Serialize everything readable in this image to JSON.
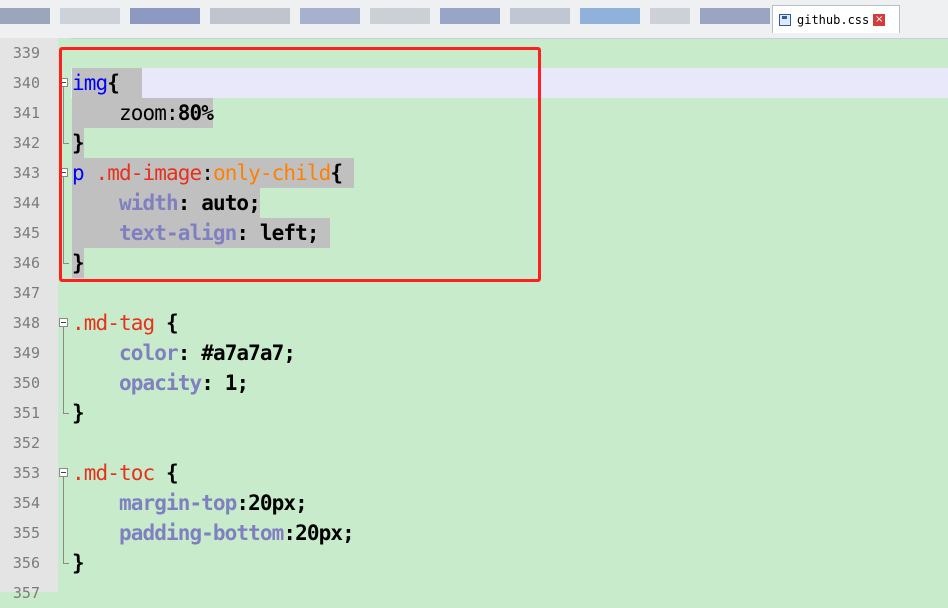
{
  "tabbar": {
    "active_tab": {
      "label": "github.css",
      "icon": "save-icon",
      "close_icon": "close-icon"
    },
    "blurred_tab_colors": [
      "#8d99b0",
      "#c7ccd4",
      "#7c8ab8",
      "#b6bcc7",
      "#9aa6c8",
      "#c4c9d1",
      "#8a98c0",
      "#b9c0cd",
      "#7fa6d6",
      "#c6cbd3",
      "#8c97b8"
    ]
  },
  "editor": {
    "lines": [
      {
        "num": "339",
        "tokens": []
      },
      {
        "num": "340",
        "tokens": [
          {
            "t": "img",
            "c": "t-sel"
          },
          {
            "t": "{",
            "c": "t-punc"
          },
          {
            "t": "  ",
            "c": "t-plain"
          }
        ]
      },
      {
        "num": "341",
        "tokens": [
          {
            "t": "    zoom:",
            "c": "t-plain"
          },
          {
            "t": "80%",
            "c": "t-val"
          }
        ]
      },
      {
        "num": "342",
        "tokens": [
          {
            "t": "}",
            "c": "t-punc"
          }
        ]
      },
      {
        "num": "343",
        "tokens": [
          {
            "t": "p ",
            "c": "t-sel"
          },
          {
            "t": ".md-image",
            "c": "t-class"
          },
          {
            "t": ":",
            "c": "t-plain"
          },
          {
            "t": "only-child",
            "c": "t-pseudo"
          },
          {
            "t": "{ ",
            "c": "t-punc"
          }
        ]
      },
      {
        "num": "344",
        "tokens": [
          {
            "t": "    ",
            "c": "t-plain"
          },
          {
            "t": "width",
            "c": "t-prop"
          },
          {
            "t": ": ",
            "c": "t-punc"
          },
          {
            "t": "auto",
            "c": "t-val"
          },
          {
            "t": ";",
            "c": "t-punc"
          }
        ]
      },
      {
        "num": "345",
        "tokens": [
          {
            "t": "    ",
            "c": "t-plain"
          },
          {
            "t": "text-align",
            "c": "t-prop"
          },
          {
            "t": ": ",
            "c": "t-punc"
          },
          {
            "t": "left",
            "c": "t-val"
          },
          {
            "t": "; ",
            "c": "t-punc"
          }
        ]
      },
      {
        "num": "346",
        "tokens": [
          {
            "t": "}",
            "c": "t-punc"
          }
        ]
      },
      {
        "num": "347",
        "tokens": []
      },
      {
        "num": "348",
        "tokens": [
          {
            "t": ".md-tag",
            "c": "t-class"
          },
          {
            "t": " {",
            "c": "t-punc"
          }
        ]
      },
      {
        "num": "349",
        "tokens": [
          {
            "t": "    ",
            "c": "t-plain"
          },
          {
            "t": "color",
            "c": "t-prop"
          },
          {
            "t": ": ",
            "c": "t-punc"
          },
          {
            "t": "#a7a7a7",
            "c": "t-val"
          },
          {
            "t": ";",
            "c": "t-punc"
          }
        ]
      },
      {
        "num": "350",
        "tokens": [
          {
            "t": "    ",
            "c": "t-plain"
          },
          {
            "t": "opacity",
            "c": "t-prop"
          },
          {
            "t": ": ",
            "c": "t-punc"
          },
          {
            "t": "1",
            "c": "t-val"
          },
          {
            "t": ";",
            "c": "t-punc"
          }
        ]
      },
      {
        "num": "351",
        "tokens": [
          {
            "t": "}",
            "c": "t-punc"
          }
        ]
      },
      {
        "num": "352",
        "tokens": []
      },
      {
        "num": "353",
        "tokens": [
          {
            "t": ".md-toc",
            "c": "t-class"
          },
          {
            "t": " {",
            "c": "t-punc"
          }
        ]
      },
      {
        "num": "354",
        "tokens": [
          {
            "t": "    ",
            "c": "t-plain"
          },
          {
            "t": "margin-top",
            "c": "t-prop"
          },
          {
            "t": ":",
            "c": "t-punc"
          },
          {
            "t": "20px",
            "c": "t-val"
          },
          {
            "t": ";",
            "c": "t-punc"
          }
        ]
      },
      {
        "num": "355",
        "tokens": [
          {
            "t": "    ",
            "c": "t-plain"
          },
          {
            "t": "padding-bottom",
            "c": "t-prop"
          },
          {
            "t": ":",
            "c": "t-punc"
          },
          {
            "t": "20px",
            "c": "t-val"
          },
          {
            "t": ";",
            "c": "t-punc"
          }
        ]
      },
      {
        "num": "356",
        "tokens": [
          {
            "t": "}",
            "c": "t-punc"
          }
        ]
      },
      {
        "num": "357",
        "tokens": []
      }
    ]
  },
  "colors": {
    "editor_bg": "#c7ebcb",
    "current_line_bg": "#e8e8fa",
    "selection_bg": "#c0c0c0",
    "annotation_border": "#ff1f1f"
  }
}
